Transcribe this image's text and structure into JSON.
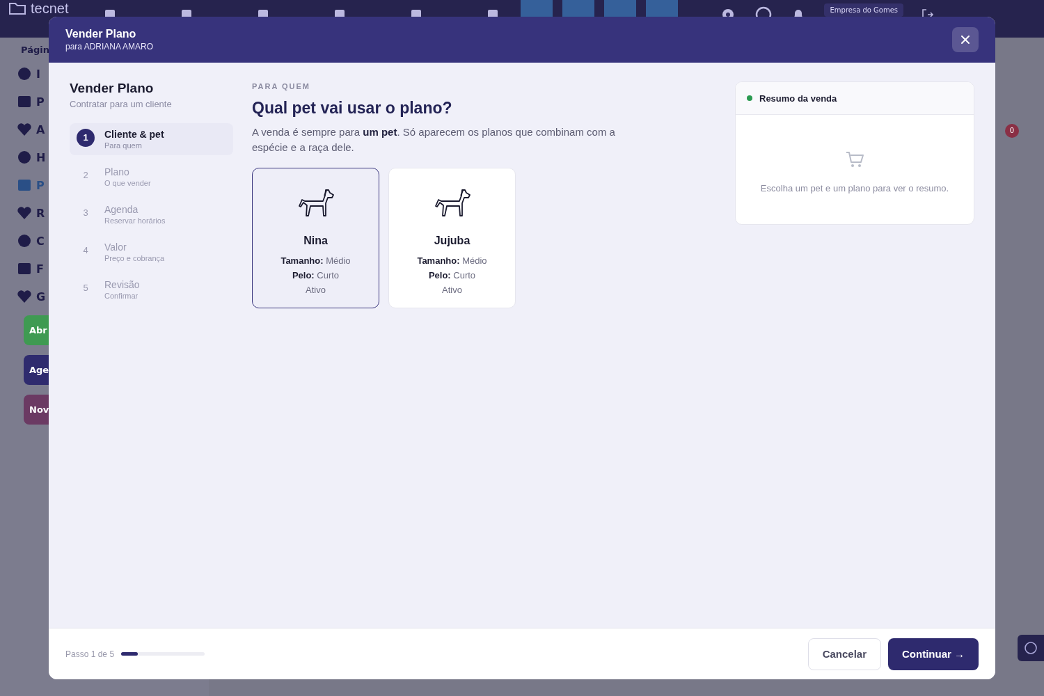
{
  "background": {
    "logo": "tecnet",
    "company": "Empresa do Gomes",
    "sidebar_heading": "Págin",
    "sidebar_items": [
      {
        "label": "I",
        "selected": false
      },
      {
        "label": "P",
        "selected": false
      },
      {
        "label": "A",
        "selected": false
      },
      {
        "label": "H",
        "selected": false
      },
      {
        "label": "P",
        "selected": true
      },
      {
        "label": "R",
        "selected": false
      },
      {
        "label": "C",
        "selected": false
      },
      {
        "label": "F",
        "selected": false
      },
      {
        "label": "G",
        "selected": false
      }
    ],
    "sidebar_buttons": [
      {
        "label": "Abr",
        "color": "#3f9a52"
      },
      {
        "label": "Age",
        "color": "#2f2b6e"
      },
      {
        "label": "Nov",
        "color": "#6b3a63"
      }
    ],
    "badge": "0"
  },
  "modal": {
    "title": "Vender Plano",
    "subtitle": "para ADRIANA AMARO",
    "steps_title": "Vender Plano",
    "steps_subtitle": "Contratar para um cliente",
    "steps": [
      {
        "number": "1",
        "title": "Cliente & pet",
        "subtitle": "Para quem",
        "selected": true
      },
      {
        "number": "2",
        "title": "Plano",
        "subtitle": "O que vender",
        "selected": false
      },
      {
        "number": "3",
        "title": "Agenda",
        "subtitle": "Reservar horários",
        "selected": false
      },
      {
        "number": "4",
        "title": "Valor",
        "subtitle": "Preço e cobrança",
        "selected": false
      },
      {
        "number": "5",
        "title": "Revisão",
        "subtitle": "Confirmar",
        "selected": false
      }
    ],
    "eyebrow": "PARA QUEM",
    "heading": "Qual pet vai usar o plano?",
    "description": "A venda é sempre para **um pet**. Só aparecem os planos que combinam com a espécie e a raça dele.",
    "pets": [
      {
        "name": "Nina",
        "size_label": "Tamanho:",
        "size": "Médio",
        "coat_label": "Pelo:",
        "coat": "Curto",
        "status": "Ativo",
        "selected": true
      },
      {
        "name": "Jujuba",
        "size_label": "Tamanho:",
        "size": "Médio",
        "coat_label": "Pelo:",
        "coat": "Curto",
        "status": "Ativo",
        "selected": false
      }
    ],
    "summary": {
      "title": "Resumo da venda",
      "empty_text": "Escolha um pet e um plano para ver o resumo."
    },
    "footer": {
      "step_text": "Passo 1 de 5",
      "level": 0.2,
      "cancel": "Cancelar",
      "continue": "Continuar →"
    }
  }
}
